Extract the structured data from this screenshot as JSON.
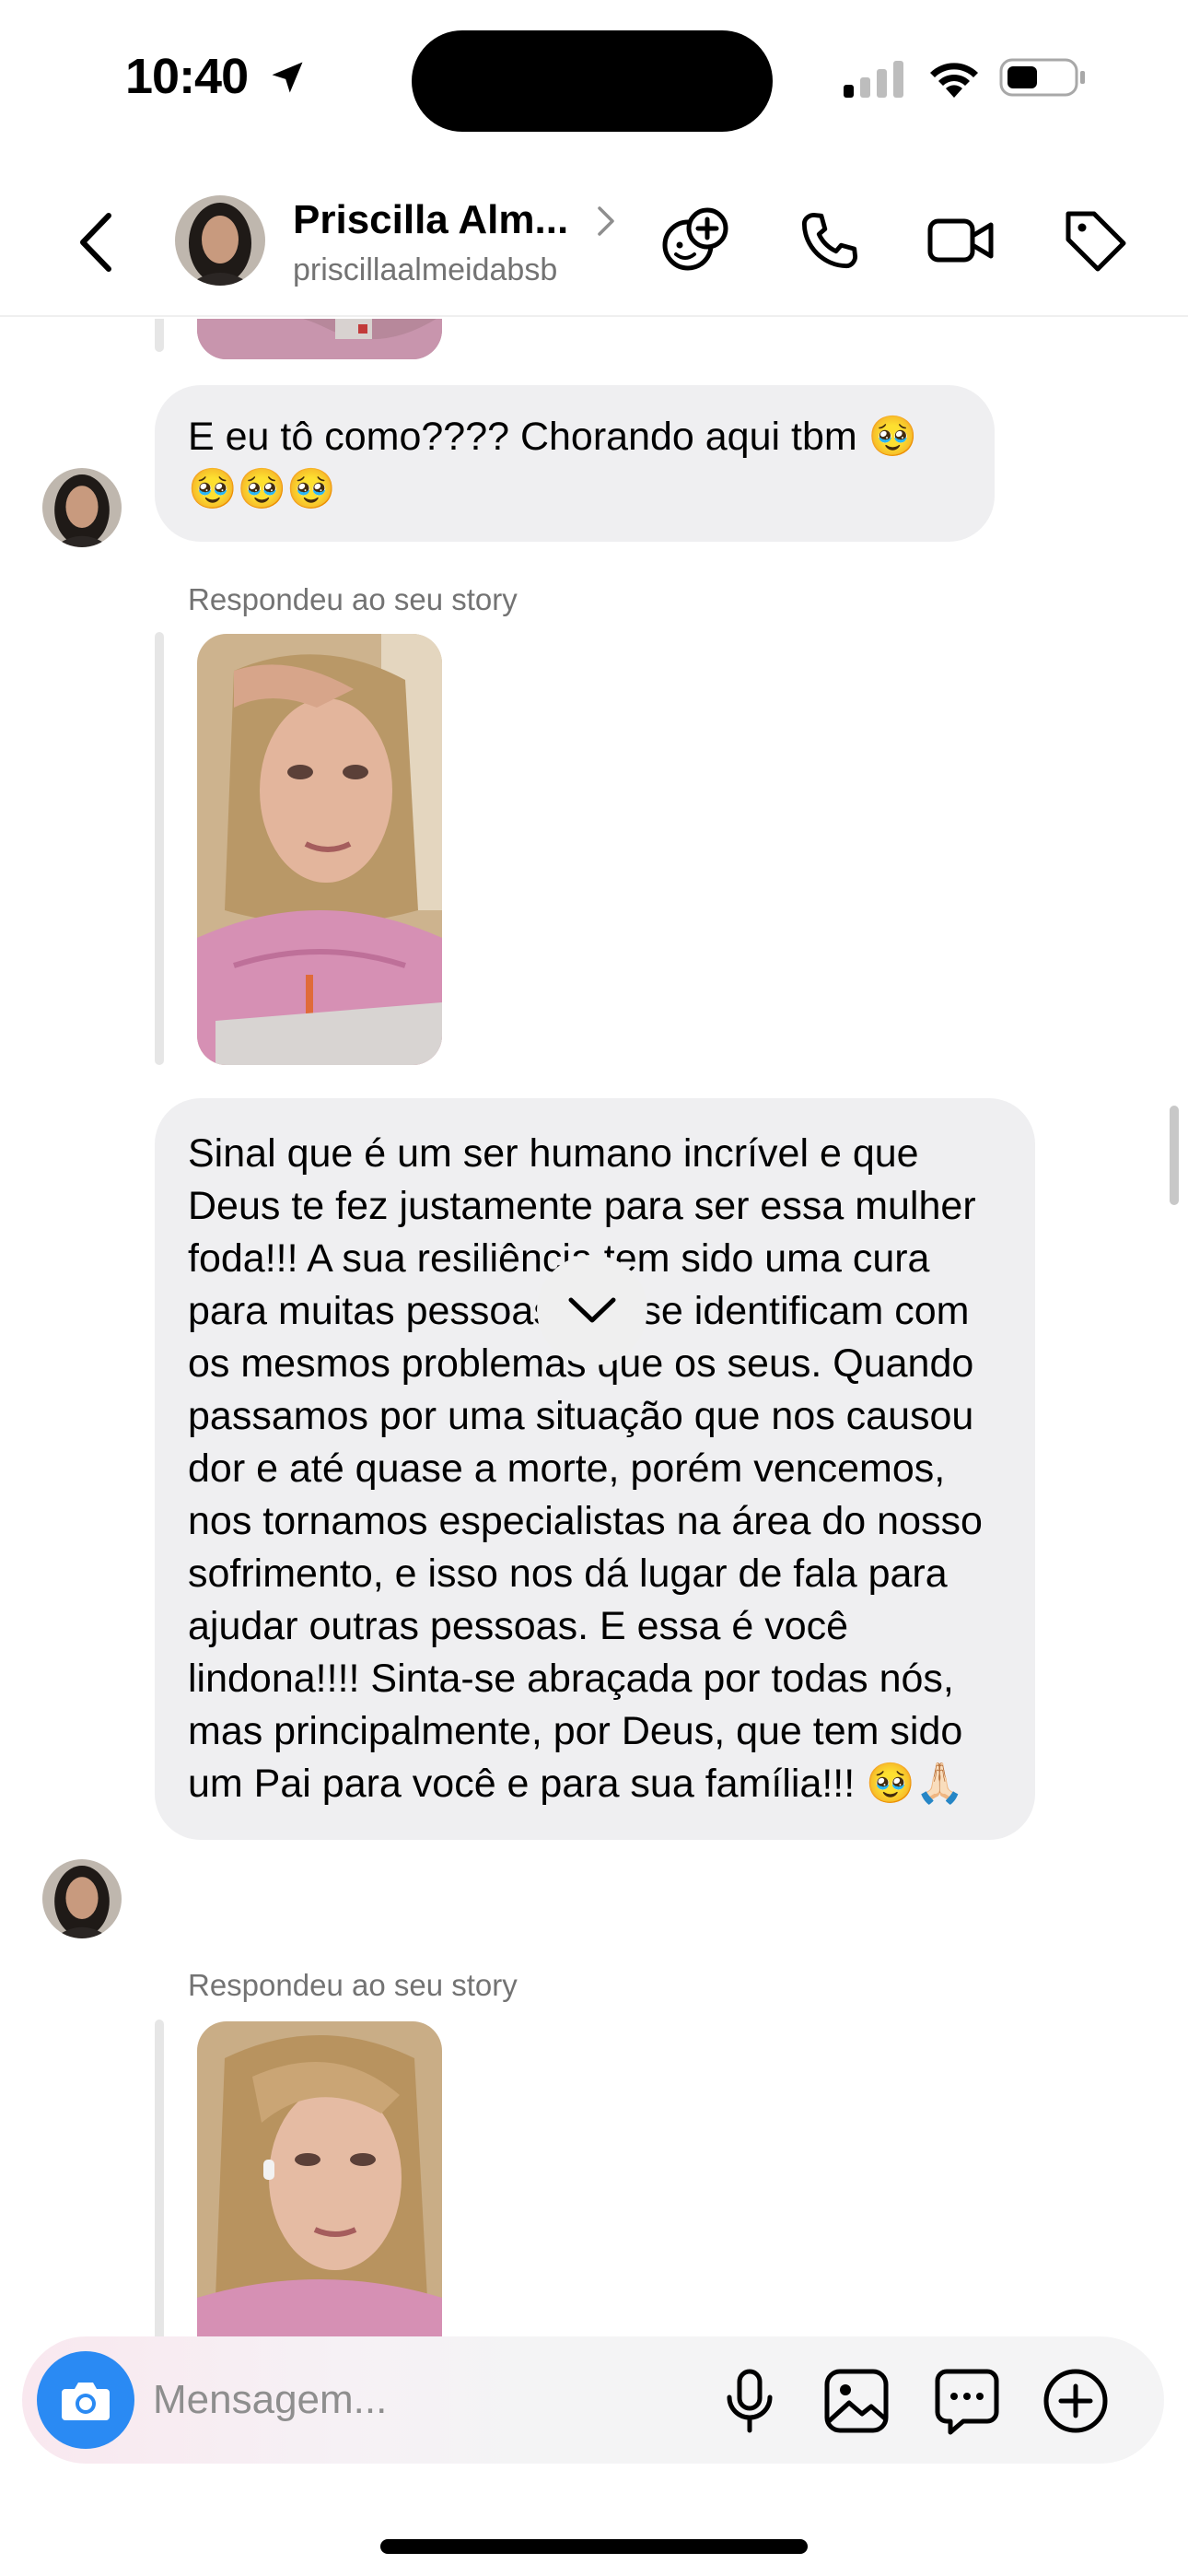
{
  "status_bar": {
    "time": "10:40"
  },
  "header": {
    "name": "Priscilla Alm...",
    "username": "priscillaalmeidabsb"
  },
  "messages": [
    {
      "type": "text",
      "text": "E eu tô como???? Chorando aqui tbm 🥹🥹🥹🥹"
    },
    {
      "type": "story_reply",
      "label": "Respondeu ao seu story"
    },
    {
      "type": "text",
      "text": "Sinal que é um ser humano incrível e que Deus te fez justamente para ser essa mulher foda!!! A sua resiliência tem sido uma cura para muitas pessoas que se identificam com os mesmos problemas que os seus. Quando passamos por uma situação que nos causou dor e até quase a morte, porém vencemos, nos tornamos especialistas na área do nosso sofrimento, e isso nos dá lugar de fala para ajudar outras pessoas. E essa é você lindona!!!! Sinta-se abraçada por todas nós, mas principalmente, por Deus, que tem sido um Pai para você e para sua família!!! 🥹🙏🏻"
    },
    {
      "type": "story_reply",
      "label": "Respondeu ao seu story"
    }
  ],
  "composer": {
    "placeholder": "Mensagem..."
  },
  "colors": {
    "accent_blue": "#2a8af3",
    "bubble_gray": "#efeff1",
    "secondary_text": "#737373"
  }
}
